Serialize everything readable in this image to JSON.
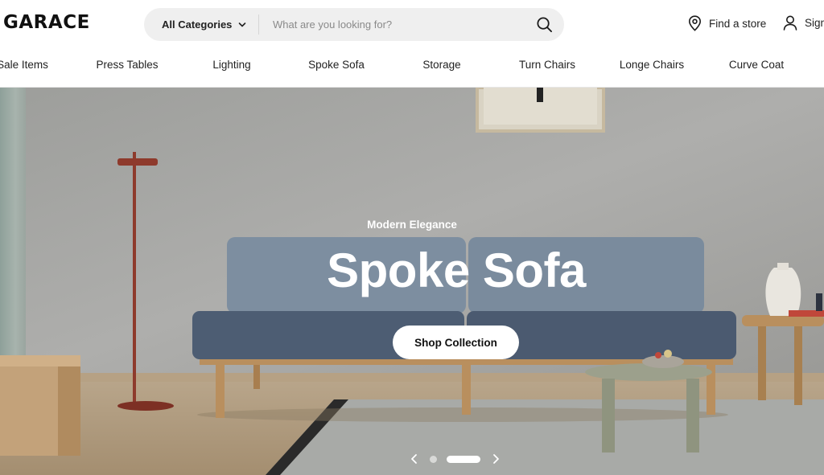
{
  "header": {
    "logo": "GARACE",
    "search": {
      "category_label": "All Categories",
      "placeholder": "What are you looking for?",
      "value": ""
    },
    "find_store": "Find a store",
    "sign_in": "Sign in"
  },
  "nav": {
    "items": [
      {
        "label": "Sale Items"
      },
      {
        "label": "Press Tables"
      },
      {
        "label": "Lighting"
      },
      {
        "label": "Spoke Sofa"
      },
      {
        "label": "Storage"
      },
      {
        "label": "Turn Chairs"
      },
      {
        "label": "Longe Chairs"
      },
      {
        "label": "Curve Coat"
      }
    ]
  },
  "hero": {
    "eyebrow": "Modern Elegance",
    "title": "Spoke Sofa",
    "cta_label": "Shop Collection",
    "slides_total": 2,
    "active_slide": 2
  },
  "icons": {
    "search": "search-icon",
    "category_dropdown": "chevron-down-icon",
    "store": "location-pin-icon",
    "account": "user-icon",
    "prev": "chevron-left-icon",
    "next": "chevron-right-icon"
  },
  "colors": {
    "wall": "#a9a9a7",
    "sofa_back": "#7d8ea0",
    "sofa_seat": "#4d5d73",
    "wood": "#b98f5e",
    "lamp": "#8e3a2c",
    "side_table": "#9ca08c"
  }
}
